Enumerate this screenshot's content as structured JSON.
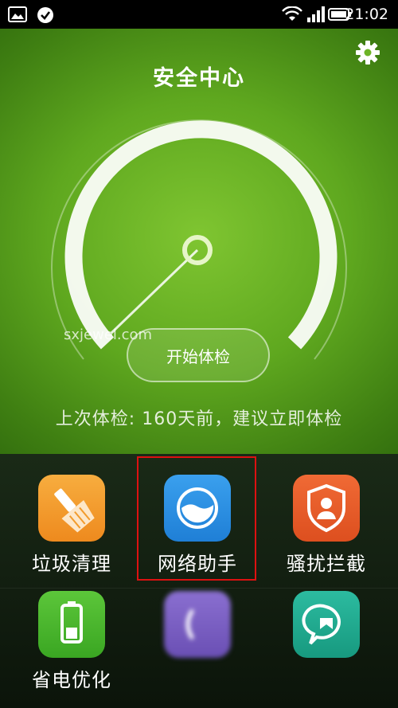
{
  "status_bar": {
    "time": "21:02",
    "icons": [
      "image-icon",
      "check-circle-icon",
      "wifi-icon",
      "signal-icon",
      "battery-icon"
    ]
  },
  "header": {
    "title": "安全中心",
    "settings_icon": "gear-icon"
  },
  "gauge": {
    "button_label": "开始体检",
    "watermark": "sxjewel.com",
    "last_check_text": "上次体检: 160天前，建议立即体检"
  },
  "tools": [
    {
      "label": "垃圾清理",
      "icon": "broom-icon",
      "color": "#f39a2a"
    },
    {
      "label": "网络助手",
      "icon": "network-icon",
      "color": "#2a8de0"
    },
    {
      "label": "骚扰拦截",
      "icon": "shield-user-icon",
      "color": "#e8562a"
    },
    {
      "label": "省电优化",
      "icon": "battery-icon",
      "color": "#48b72e"
    },
    {
      "label": "",
      "icon": "app-icon",
      "color": "#7a5ec0"
    },
    {
      "label": "",
      "icon": "chat-bubble-icon",
      "color": "#1fa88e"
    }
  ],
  "colors": {
    "hero_green": "#5fa81f",
    "highlight_red": "#d11111"
  }
}
